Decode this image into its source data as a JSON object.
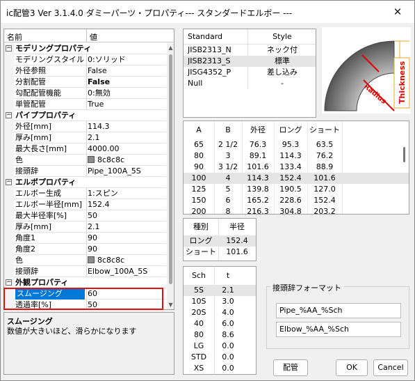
{
  "window": {
    "title": "ic配管3 Ver 3.1.4.0 ダミーパーツ・プロパティ--- スタンダードエルボー ---",
    "close_glyph": "✕"
  },
  "property_grid": {
    "headers": {
      "name": "名前",
      "value": "値"
    },
    "rows": [
      {
        "type": "category",
        "toggle": "−",
        "name": "モデリングプロパティ"
      },
      {
        "type": "prop",
        "name": "モデリングスタイル",
        "value": "0:ソリッド"
      },
      {
        "type": "prop",
        "name": "外径参照",
        "value": "False"
      },
      {
        "type": "prop",
        "name": "分割配管",
        "value": "False",
        "bold": true
      },
      {
        "type": "prop",
        "name": "勾配配管機能",
        "value": "0:無効"
      },
      {
        "type": "prop",
        "name": "単管配管",
        "value": "True"
      },
      {
        "type": "category",
        "toggle": "−",
        "name": "パイププロパティ"
      },
      {
        "type": "prop",
        "name": "外径[mm]",
        "value": "114.3"
      },
      {
        "type": "prop",
        "name": "厚み[mm]",
        "value": "2.1"
      },
      {
        "type": "prop",
        "name": "最大長さ[mm]",
        "value": "4000.00"
      },
      {
        "type": "prop",
        "name": "色",
        "value": "8c8c8c",
        "swatch": "#8c8c8c"
      },
      {
        "type": "prop",
        "name": "接頭辞",
        "value": "Pipe_100A_5S"
      },
      {
        "type": "category",
        "toggle": "−",
        "name": "エルボプロパティ"
      },
      {
        "type": "prop",
        "name": "エルボー生成",
        "value": "1:スピン"
      },
      {
        "type": "prop",
        "name": "エルボー半径[mm]",
        "value": "152.4"
      },
      {
        "type": "prop",
        "name": "最大半径率[%]",
        "value": "50"
      },
      {
        "type": "prop",
        "name": "厚み[mm]",
        "value": "2.1"
      },
      {
        "type": "prop",
        "name": "角度1",
        "value": "90"
      },
      {
        "type": "prop",
        "name": "角度2",
        "value": "90"
      },
      {
        "type": "prop",
        "name": "色",
        "value": "8c8c8c",
        "swatch": "#8c8c8c"
      },
      {
        "type": "prop",
        "name": "接頭辞",
        "value": "Elbow_100A_5S"
      },
      {
        "type": "category",
        "toggle": "−",
        "name": "外観プロパティ"
      },
      {
        "type": "prop",
        "name": "スムージング",
        "value": "60",
        "selected": true
      },
      {
        "type": "prop",
        "name": "透過率[%]",
        "value": "50"
      }
    ]
  },
  "description": {
    "title": "スムージング",
    "text": "数値が大きいほど、滑らかになります"
  },
  "standard_table": {
    "headers": [
      "Standard",
      "Style"
    ],
    "rows": [
      [
        "JISB2313_N",
        "ネック付"
      ],
      [
        "JISB2313_S",
        "標準"
      ],
      [
        "JISG4352_P",
        "差し込み"
      ],
      [
        "Null",
        "-"
      ]
    ],
    "selected": 1
  },
  "diagram": {
    "thickness_label": "Thickness",
    "radius_label": "Radius",
    "pipe_color": "#8c8c8c",
    "accent_color": "#e00000",
    "dim_color": "#f5a020"
  },
  "dimension_table": {
    "headers": [
      "A",
      "B",
      "外径",
      "ロング",
      "ショート"
    ],
    "rows": [
      [
        "65",
        "2 1/2",
        "76.3",
        "95.3",
        "63.5"
      ],
      [
        "80",
        "3",
        "89.1",
        "114.3",
        "76.2"
      ],
      [
        "90",
        "3 1/2",
        "101.6",
        "133.4",
        "88.9"
      ],
      [
        "100",
        "4",
        "114.3",
        "152.4",
        "101.6"
      ],
      [
        "125",
        "5",
        "139.8",
        "190.5",
        "127.0"
      ],
      [
        "150",
        "6",
        "165.2",
        "228.6",
        "152.4"
      ],
      [
        "200",
        "8",
        "216.3",
        "304.8",
        "203.2"
      ]
    ],
    "selected": 3
  },
  "radius_table": {
    "headers": [
      "種別",
      "半径"
    ],
    "rows": [
      [
        "ロング",
        "152.4"
      ],
      [
        "ショート",
        "101.6"
      ]
    ],
    "selected": 0
  },
  "sch_table": {
    "headers": [
      "Sch",
      "t"
    ],
    "rows": [
      [
        "5S",
        "2.1"
      ],
      [
        "10S",
        "3.0"
      ],
      [
        "20S",
        "4.0"
      ],
      [
        "40",
        "6.0"
      ],
      [
        "80",
        "8.6"
      ],
      [
        "LG",
        "0.0"
      ],
      [
        "STD",
        "0.0"
      ],
      [
        "XS",
        "0.0"
      ]
    ],
    "selected": 0
  },
  "prefix_format": {
    "title": "接頭辞フォーマット",
    "pipe_format": "Pipe_%AA_%Sch",
    "elbow_format": "Elbow_%AA_%Sch"
  },
  "buttons": {
    "piping": "配管",
    "ok": "OK",
    "cancel": "Cancel"
  },
  "accent": {
    "selection": "#0078d7",
    "highlight_box": "#e01010"
  }
}
